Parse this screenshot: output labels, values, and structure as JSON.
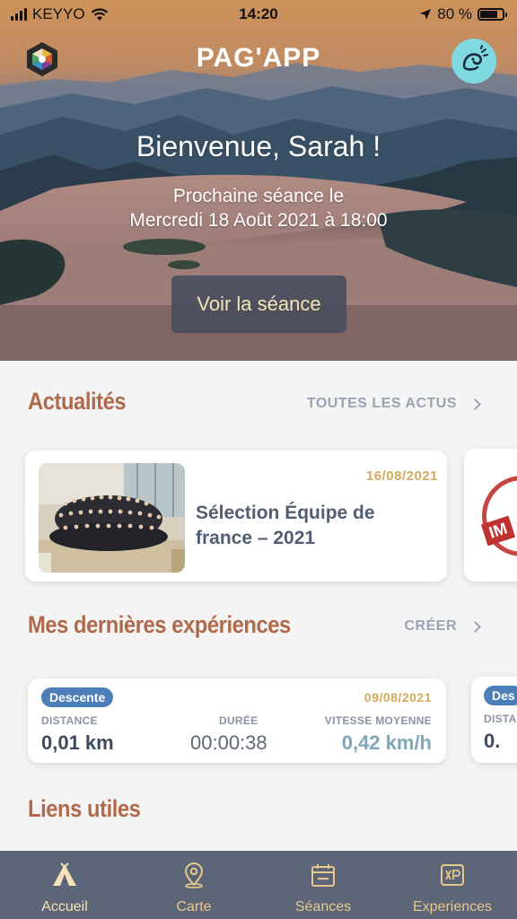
{
  "status_bar": {
    "carrier": "KEYYO",
    "time": "14:20",
    "battery": "80 %",
    "battery_level": 0.8
  },
  "header": {
    "brand": "PAG'APP"
  },
  "hero": {
    "greeting": "Bienvenue, Sarah !",
    "next_session_line1": "Prochaine séance le",
    "next_session_line2": "Mercredi 18 Août 2021 à 18:00",
    "button_label": "Voir la séance"
  },
  "news": {
    "title": "Actualités",
    "link_label": "TOUTES LES ACTUS",
    "items": [
      {
        "date": "16/08/2021",
        "title": "Sélection Équipe de france – 2021"
      }
    ],
    "peek_stamp": "IM"
  },
  "experiences": {
    "title": "Mes dernières expériences",
    "link_label": "CRÉER",
    "items": [
      {
        "badge": "Descente",
        "date": "09/08/2021",
        "distance_label": "DISTANCE",
        "distance_value": "0,01 km",
        "duration_label": "DURÉE",
        "duration_value": "00:00:38",
        "speed_label": "VITESSE MOYENNE",
        "speed_value": "0,42 km/h"
      }
    ],
    "peek": {
      "badge": "Des",
      "label": "DISTA",
      "value": "0."
    }
  },
  "links": {
    "title": "Liens utiles"
  },
  "tabbar": {
    "items": [
      {
        "label": "Accueil",
        "icon": "tent-icon",
        "active": true
      },
      {
        "label": "Carte",
        "icon": "map-pin-icon",
        "active": false
      },
      {
        "label": "Séances",
        "icon": "calendar-icon",
        "active": false
      },
      {
        "label": "Experiences",
        "icon": "xp-icon",
        "active": false
      }
    ],
    "active_color": "#f5e3b8",
    "inactive_color": "#e7c98c"
  },
  "colors": {
    "accent_brown": "#b06a4b",
    "date_gold": "#d6a95a",
    "badge_blue": "#4c7fb8",
    "speed_teal": "#7ea8b6"
  }
}
